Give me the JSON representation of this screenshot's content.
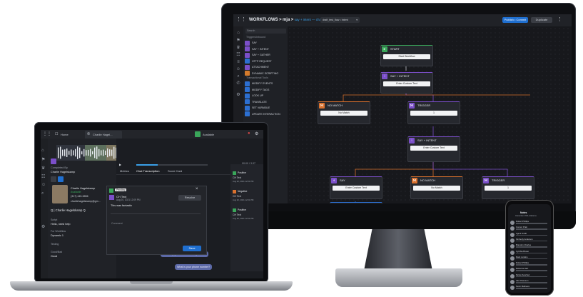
{
  "monitor": {
    "breadcrumb": {
      "root": "WORKFLOWS",
      "sep1": ">",
      "project": "mja",
      "sep2": ">",
      "path": "say + intent — chatby",
      "sep3": ">"
    },
    "version_select": "draft_test_flow • Intent",
    "publish_button": "Publish • Commit",
    "duplicate_button": "Duplicate",
    "more_menu": "⋮",
    "panel": {
      "search_placeholder": "Search",
      "section_1": "Triggers/Inbound",
      "section_2": "Transactional Tools",
      "items_1": [
        {
          "label": "SAY",
          "color": "#7b4fc9"
        },
        {
          "label": "SAY + INTENT",
          "color": "#7b4fc9"
        },
        {
          "label": "SAY + GATHER",
          "color": "#7b4fc9"
        },
        {
          "label": "HTTP REQUEST",
          "color": "#2c6fd1"
        },
        {
          "label": "ATTACHMENT",
          "color": "#7b4fc9"
        },
        {
          "label": "DYNAMIC SCRIPTING",
          "color": "#d47b2c"
        }
      ],
      "items_2": [
        {
          "label": "MODIFY EVENTS",
          "color": "#2c6fd1"
        },
        {
          "label": "MODIFY TAGS",
          "color": "#2c6fd1"
        },
        {
          "label": "LOOK UP",
          "color": "#2c6fd1"
        },
        {
          "label": "TRANSLATE",
          "color": "#2c6fd1"
        },
        {
          "label": "SET VARIABLE",
          "color": "#2c6fd1"
        },
        {
          "label": "UPDATE INTERACTION",
          "color": "#2c6fd1"
        }
      ]
    },
    "nodes": {
      "start": {
        "title": "START",
        "body": "Start Workflow",
        "color": "#3aa65a"
      },
      "say_intent_1": {
        "title": "SAY + INTENT",
        "body": "Enter Custom Text",
        "color": "#7b4fc9"
      },
      "no_match_1": {
        "title": "NO MATCH",
        "body": "No Match",
        "color": "#d9712e"
      },
      "trigger_1": {
        "title": "TRIGGER",
        "body": "1",
        "color": "#7b4fc9"
      },
      "say_intent_2": {
        "title": "SAY + INTENT",
        "body": "Enter Custom Text",
        "color": "#7b4fc9"
      },
      "say": {
        "title": "SAY",
        "body": "Enter Custom Text",
        "color": "#7b4fc9"
      },
      "no_match_2": {
        "title": "NO MATCH",
        "body": "No Match",
        "color": "#d9712e"
      },
      "trigger_2": {
        "title": "TRIGGER",
        "body": "1",
        "color": "#7b4fc9"
      },
      "hang_up": {
        "title": "HANG UP",
        "body": "",
        "color": "#2c6fd1"
      }
    }
  },
  "laptop": {
    "home_label": "Home",
    "contact_tab": "Charlie Hagel...",
    "status": "Available",
    "notif_count": "2",
    "completed_by_label": "Completed By",
    "completed_by": "Charlie Hagelskamp",
    "contact_name": "Charlie Hagelskamp",
    "contact_status": "Available",
    "contact_phone": "(317) 445-5856",
    "contact_email": "charliehagelskamp@gm...",
    "search_text": "Q | Charlie Hagelskamp Q",
    "script_label": "Script",
    "script_value": "Hello, need help",
    "for_workflow_label": "For Workflow",
    "for_workflow_value": "Dynamic 1",
    "testing_label": "Testing",
    "good_bad_label": "Good/Bad",
    "good_bad_value": "Good",
    "timer": "00:00 / 3:37",
    "tabs": [
      "Metrics",
      "Chat Transcription",
      "Score Card"
    ],
    "modal": {
      "badge": "Pending",
      "title": "CH Text",
      "date": "Aug 20, 2021 12:09 PM",
      "body": "This was fantastic",
      "resolve_button": "Resolve",
      "comment_placeholder": "Comment",
      "save_button": "Save"
    },
    "chat": [
      "I can help you with that",
      "I can help you with whatever you need",
      "What is your phone number?"
    ],
    "feed": [
      {
        "tag": "Positive",
        "badge": "CH Text",
        "date": "Aug 20, 2021 12:01 PM"
      },
      {
        "tag": "Negative",
        "badge": "CH Text",
        "date": "Aug 20, 2021 12:01 PM"
      },
      {
        "tag": "Positive",
        "badge": "CH Text",
        "date": "Aug 20, 2021 12:01 PM"
      }
    ],
    "close_symbol": "×"
  },
  "phone": {
    "header": "Notes",
    "sub": "Interaction 4501-Alabama",
    "rows": [
      "Robert Phillips",
      "Connor Pratt",
      "Agent Smith",
      "Kimberly Anderson",
      "Brandon Charles",
      "Cynthia Brown",
      "Mark Jenkins",
      "Robert Phillips",
      "Rebecca Hart",
      "Nicole Sanchez",
      "Alex Peterson",
      "Kevin Mathews"
    ]
  },
  "colors": {
    "accent_blue": "#1f6fd0",
    "purple": "#7b4fc9",
    "orange": "#d9712e",
    "green": "#3aa65a",
    "teal": "#1aa3a3"
  }
}
